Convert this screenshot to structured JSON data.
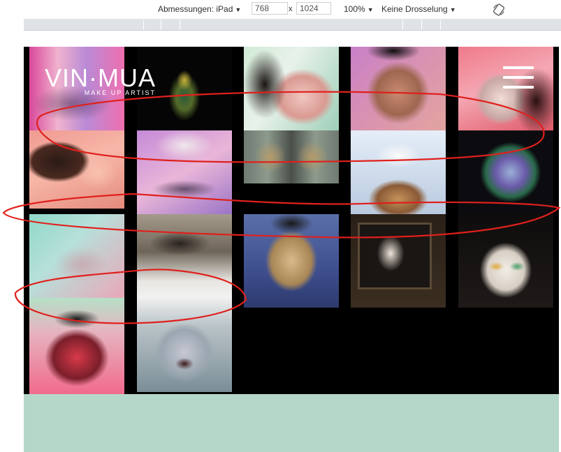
{
  "devtools": {
    "dimensions_label": "Abmessungen: iPad",
    "width_value": "768",
    "times": "x",
    "height_value": "1024",
    "zoom": "100%",
    "throttle": "Keine Drosselung"
  },
  "site": {
    "logo": "VIN·MUA",
    "tagline": "MAKE UP ARTIST",
    "menu_icon": "hamburger-icon"
  },
  "colors": {
    "background": "#000000",
    "footer": "#b5d7c9",
    "annotation": "#e0201c"
  },
  "gallery_count": 18
}
